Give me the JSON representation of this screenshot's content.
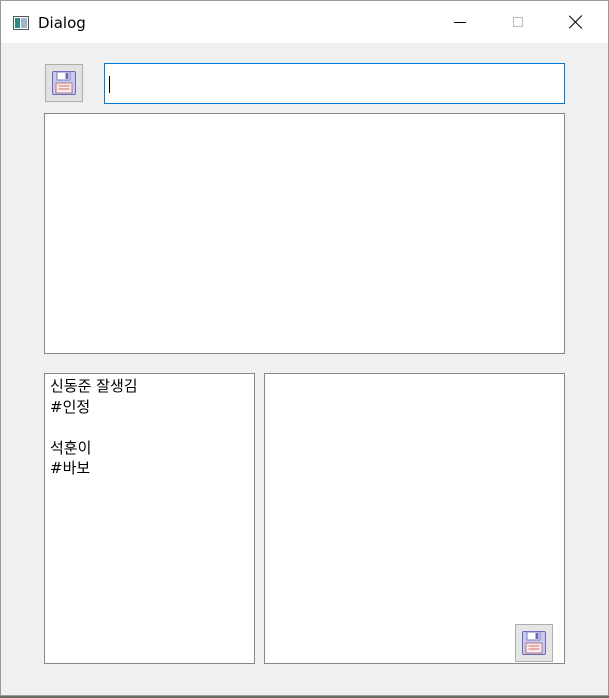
{
  "window": {
    "title": "Dialog"
  },
  "titlebar_buttons": {
    "minimize_icon": "minimize-icon",
    "maximize_icon": "maximize-icon",
    "close_icon": "close-icon"
  },
  "top_input": {
    "value": ""
  },
  "save_icon": "floppy-disk-icon",
  "left_list": {
    "lines": [
      "신동준 잘생김",
      "#인정",
      "",
      "석훈이",
      "#바보"
    ]
  },
  "colors": {
    "focus_border": "#0078d7",
    "window_bg": "#f0f0f0",
    "titlebar_bg": "#ffffff"
  }
}
